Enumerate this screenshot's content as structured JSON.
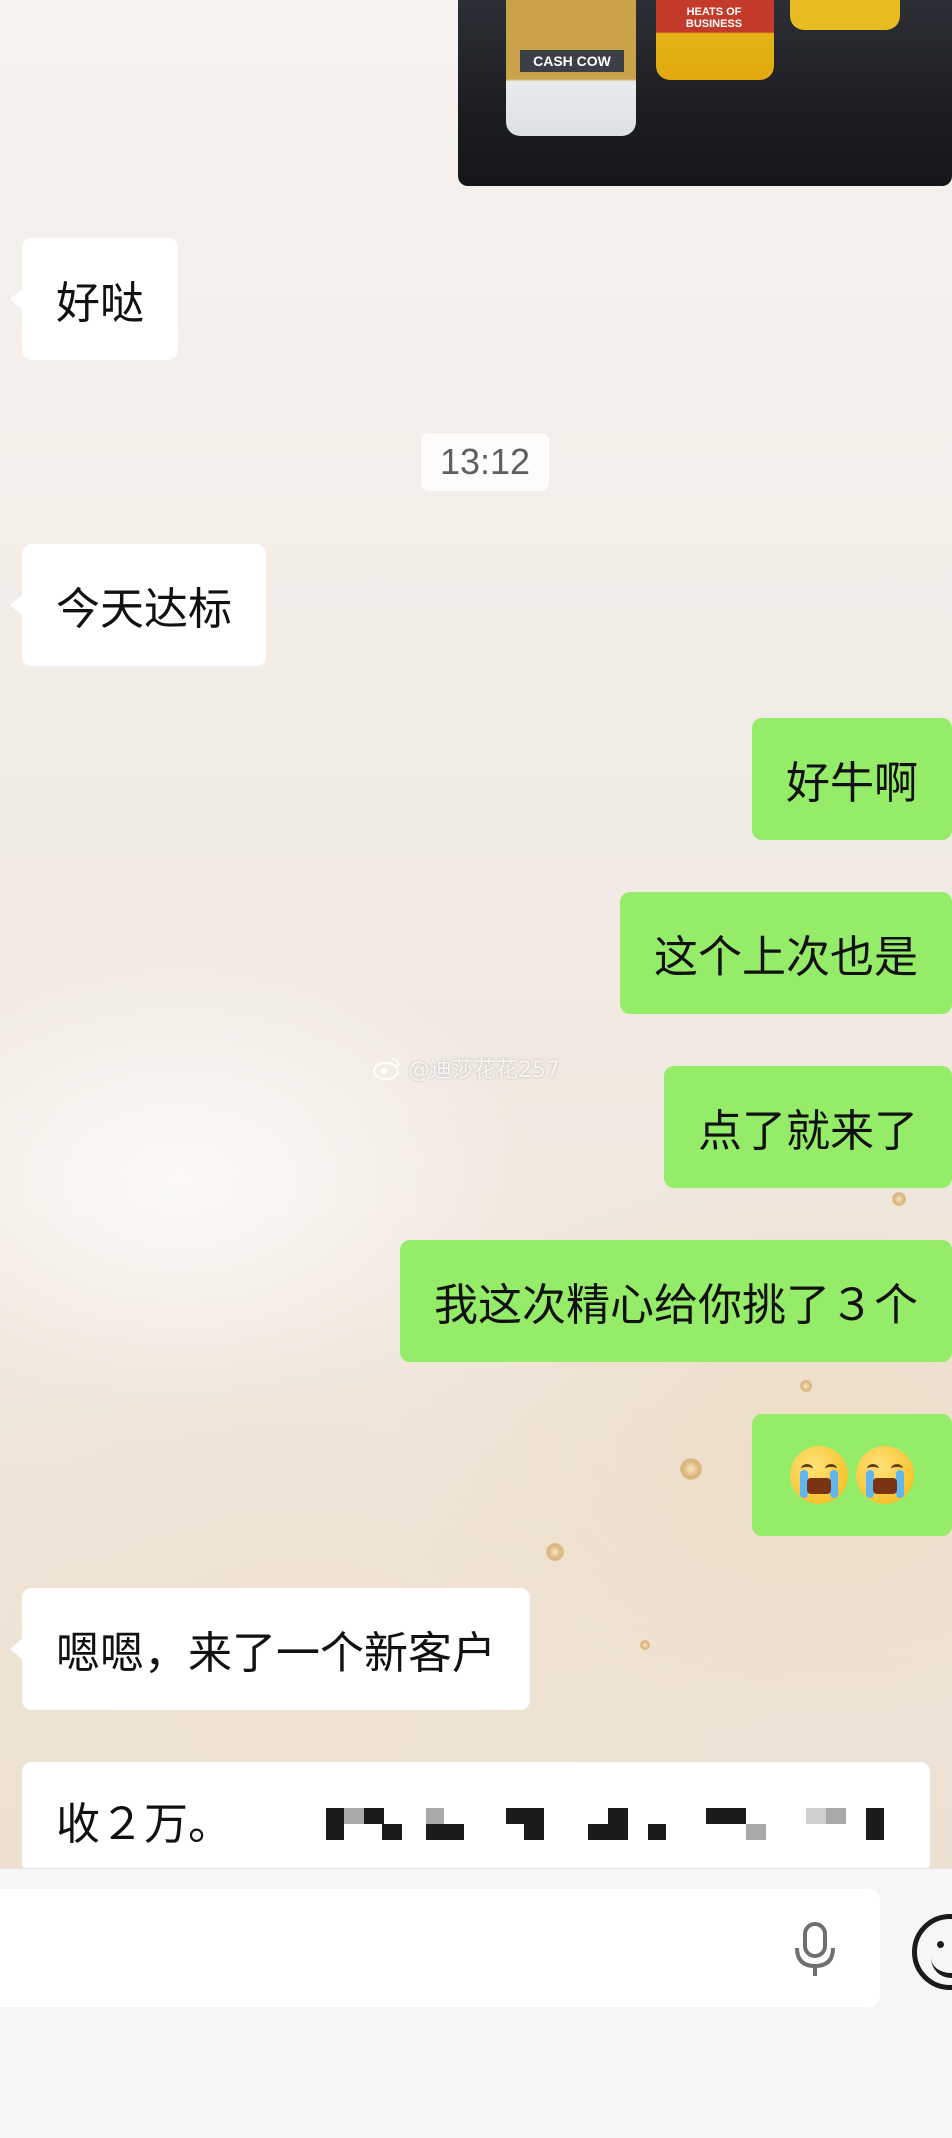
{
  "conversation": {
    "photo": {
      "bottle_label": "CASH COW",
      "bottle_label_2": "HEATS OF BUSINESS"
    },
    "messages": [
      {
        "side": "in",
        "text": "好哒"
      },
      {
        "side": "in",
        "text": "今天达标"
      },
      {
        "side": "out",
        "text": "好牛啊"
      },
      {
        "side": "out",
        "text": "这个上次也是"
      },
      {
        "side": "out",
        "text": "点了就来了"
      },
      {
        "side": "out",
        "text": "我这次精心给你挑了３个"
      },
      {
        "side": "out",
        "text": "😭😭",
        "emoji": "crying-face-icon x2"
      },
      {
        "side": "in",
        "text": "嗯嗯，来了一个新客户"
      },
      {
        "side": "in",
        "text": "收２万。"
      }
    ],
    "timestamp": "13:12",
    "watermark": "@迪莎花花257"
  },
  "colors": {
    "incoming_bubble": "#ffffff",
    "outgoing_bubble": "#95ec69",
    "input_panel": "#f6f6f6"
  },
  "input_bar": {
    "voice_icon": "microphone-icon",
    "emoji_icon": "smiley-icon"
  }
}
